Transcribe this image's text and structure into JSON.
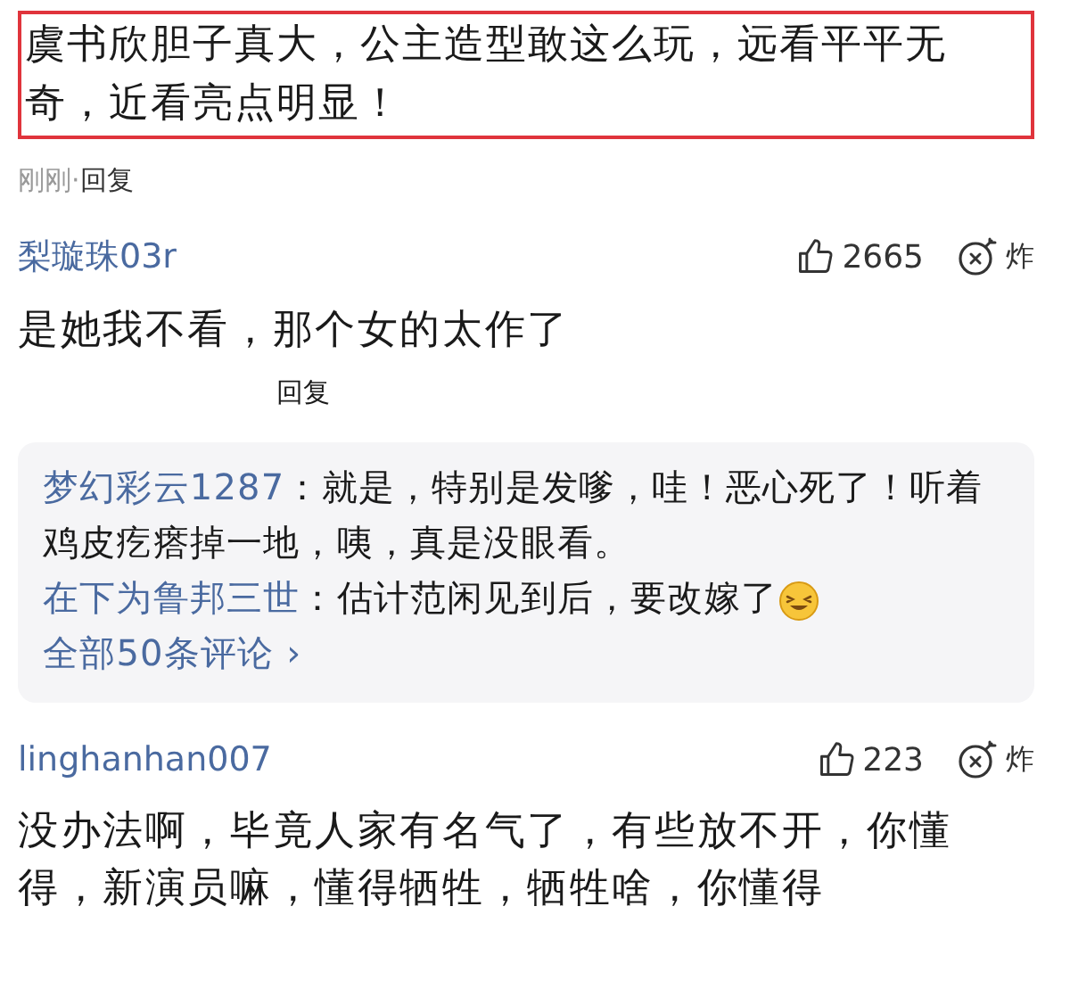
{
  "post": {
    "text": "虞书欣胆子真大，公主造型敢这么玩，远看平平无奇，近看亮点明显！",
    "highlighted": true
  },
  "post_meta": {
    "time": "刚刚",
    "separator": "·",
    "reply": "回复"
  },
  "comments": [
    {
      "user": "梨璇珠03r",
      "likes": "2665",
      "bomb": "炸",
      "text": "是她我不看，那个女的太作了",
      "reply": "回复",
      "replies": [
        {
          "user": "梦幻彩云1287",
          "separator": "：",
          "text": "就是，特别是发嗲，哇！恶心死了！听着鸡皮疙瘩掉一地，咦，真是没眼看。",
          "emoji": false
        },
        {
          "user": "在下为鲁邦三世",
          "separator": "：",
          "text": "估计范闲见到后，要改嫁了",
          "emoji": true
        }
      ],
      "more": "全部50条评论",
      "more_arrow": "›"
    },
    {
      "user": "linghanhan007",
      "likes": "223",
      "bomb": "炸",
      "text": "没办法啊，毕竟人家有名气了，有些放不开，你懂得，新演员嘛，懂得牺牲，牺牲啥，你懂得"
    }
  ]
}
